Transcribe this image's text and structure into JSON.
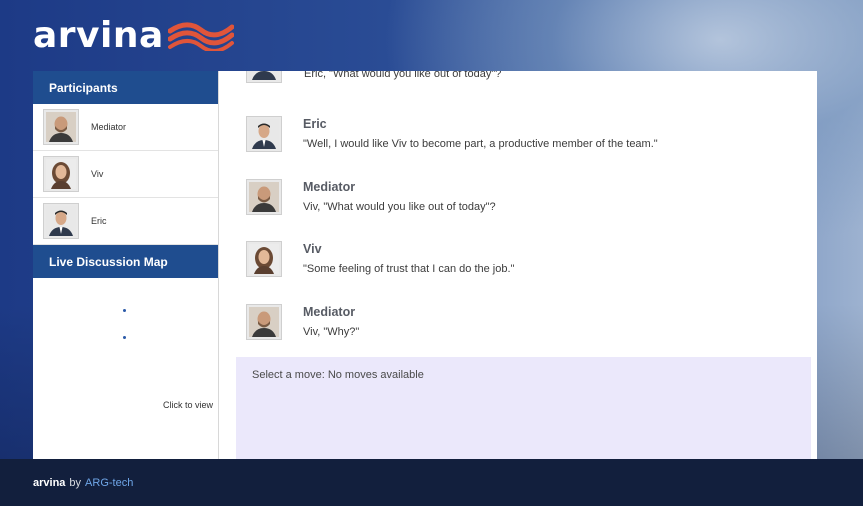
{
  "app": {
    "logo_text": "arvina"
  },
  "sidebar": {
    "participants_title": "Participants",
    "participants": [
      {
        "name": "Mediator",
        "avatar": "bald-bearded-man"
      },
      {
        "name": "Viv",
        "avatar": "woman-brown-hair"
      },
      {
        "name": "Eric",
        "avatar": "man-dark-hair-suit"
      }
    ],
    "map_title": "Live Discussion Map",
    "click_to_view": "Click to view"
  },
  "dialogue": {
    "partial_text": "Eric, \"What would you like out of today\"?",
    "messages": [
      {
        "speaker": "Eric",
        "text": "\"Well, I would like Viv to become part, a productive member of the team.\"",
        "avatar": "man-dark-hair-suit"
      },
      {
        "speaker": "Mediator",
        "text": "Viv, \"What would you like out of today\"?",
        "avatar": "bald-bearded-man"
      },
      {
        "speaker": "Viv",
        "text": "\"Some feeling of trust that I can do the job.\"",
        "avatar": "woman-brown-hair"
      },
      {
        "speaker": "Mediator",
        "text": "Viv, \"Why?\"",
        "avatar": "bald-bearded-man"
      }
    ],
    "move_prompt": "Select a move: No moves available"
  },
  "footer": {
    "brand": "arvina",
    "by": "by",
    "link": "ARG-tech"
  },
  "colors": {
    "panel_header": "#1f4d8f",
    "footer_bg": "#121f3d",
    "move_box": "#ebe8fb",
    "link": "#6fa6e8"
  }
}
